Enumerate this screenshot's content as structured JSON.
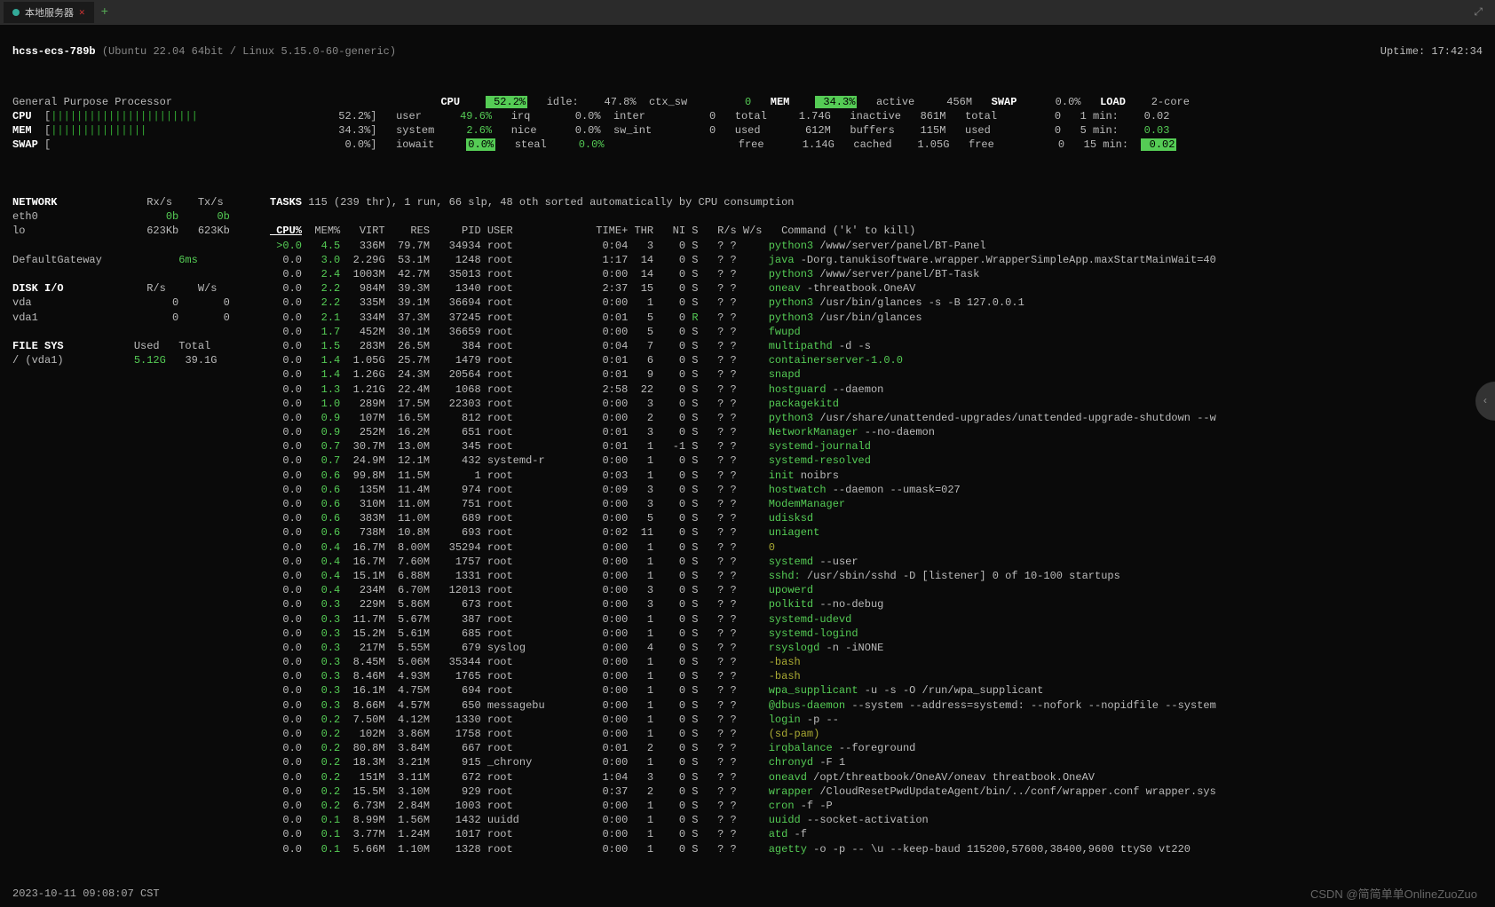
{
  "tab": {
    "label": "本地服务器"
  },
  "header": {
    "host": "hcss-ecs-789b",
    "os": "(Ubuntu 22.04 64bit / Linux 5.15.0-60-generic)",
    "uptime_label": "Uptime:",
    "uptime": "17:42:34"
  },
  "proc_title": "General Purpose Processor",
  "bars": {
    "cpu": {
      "label": "CPU",
      "pct": "52.2%"
    },
    "mem": {
      "label": "MEM",
      "pct": "34.3%"
    },
    "swap": {
      "label": "SWAP",
      "pct": "0.0%"
    }
  },
  "cpu_box": {
    "label": "CPU",
    "main": "52.2%",
    "rows": [
      [
        "user",
        "49.6%",
        "irq",
        "0.0%"
      ],
      [
        "system",
        "2.6%",
        "nice",
        "0.0%"
      ],
      [
        "iowait",
        "0.0%",
        "steal",
        "0.0%"
      ]
    ],
    "extra": [
      [
        "idle:",
        "47.8%",
        "ctx_sw",
        "0"
      ],
      [
        "",
        "",
        "inter",
        "0"
      ],
      [
        "",
        "",
        "sw_int",
        "0"
      ]
    ]
  },
  "mem_box": {
    "label": "MEM",
    "main": "34.3%",
    "rows": [
      [
        "total",
        "1.74G",
        "active",
        "456M"
      ],
      [
        "used",
        "612M",
        "inactive",
        "861M"
      ],
      [
        "free",
        "1.14G",
        "buffers",
        "115M"
      ],
      [
        "",
        "",
        "cached",
        "1.05G"
      ]
    ]
  },
  "swap_box": {
    "label": "SWAP",
    "main": "0.0%",
    "rows": [
      [
        "total",
        "0"
      ],
      [
        "used",
        "0"
      ],
      [
        "free",
        "0"
      ]
    ]
  },
  "load_box": {
    "label": "LOAD",
    "main": "2-core",
    "rows": [
      [
        "1 min:",
        "0.02"
      ],
      [
        "5 min:",
        "0.03"
      ],
      [
        "15 min:",
        "0.02"
      ]
    ]
  },
  "network": {
    "title": "NETWORK",
    "hdr": [
      "Rx/s",
      "Tx/s"
    ],
    "rows": [
      [
        "eth0",
        "0b",
        "0b"
      ],
      [
        "lo",
        "623Kb",
        "623Kb"
      ]
    ],
    "gw": [
      "DefaultGateway",
      "6ms"
    ]
  },
  "diskio": {
    "title": "DISK I/O",
    "hdr": [
      "R/s",
      "W/s"
    ],
    "rows": [
      [
        "vda",
        "0",
        "0"
      ],
      [
        "vda1",
        "0",
        "0"
      ]
    ]
  },
  "fs": {
    "title": "FILE SYS",
    "hdr": [
      "Used",
      "Total"
    ],
    "rows": [
      [
        "/ (vda1)",
        "5.12G",
        "39.1G"
      ]
    ]
  },
  "tasks_hdr": "TASKS 115 (239 thr), 1 run, 66 slp, 48 oth sorted automatically by CPU consumption",
  "cols": [
    "CPU%",
    "MEM%",
    "VIRT",
    "RES",
    "PID",
    "USER",
    "TIME+",
    "THR",
    "NI",
    "S",
    "R/s",
    "W/s",
    "Command ('k' to kill)"
  ],
  "procs": [
    [
      ">0.0",
      "4.5",
      "336M",
      "79.7M",
      "34934",
      "root",
      "0:04",
      "3",
      "0",
      "S",
      "?",
      "?",
      "python3",
      " /www/server/panel/BT-Panel"
    ],
    [
      "0.0",
      "3.0",
      "2.29G",
      "53.1M",
      "1248",
      "root",
      "1:17",
      "14",
      "0",
      "S",
      "?",
      "?",
      "java",
      " -Dorg.tanukisoftware.wrapper.WrapperSimpleApp.maxStartMainWait=40"
    ],
    [
      "0.0",
      "2.4",
      "1003M",
      "42.7M",
      "35013",
      "root",
      "0:00",
      "14",
      "0",
      "S",
      "?",
      "?",
      "python3",
      " /www/server/panel/BT-Task"
    ],
    [
      "0.0",
      "2.2",
      "984M",
      "39.3M",
      "1340",
      "root",
      "2:37",
      "15",
      "0",
      "S",
      "?",
      "?",
      "oneav",
      " -threatbook.OneAV"
    ],
    [
      "0.0",
      "2.2",
      "335M",
      "39.1M",
      "36694",
      "root",
      "0:00",
      "1",
      "0",
      "S",
      "?",
      "?",
      "python3",
      " /usr/bin/glances -s -B 127.0.0.1"
    ],
    [
      "0.0",
      "2.1",
      "334M",
      "37.3M",
      "37245",
      "root",
      "0:01",
      "5",
      "0",
      "R",
      "?",
      "?",
      "python3",
      " /usr/bin/glances"
    ],
    [
      "0.0",
      "1.7",
      "452M",
      "30.1M",
      "36659",
      "root",
      "0:00",
      "5",
      "0",
      "S",
      "?",
      "?",
      "fwupd",
      ""
    ],
    [
      "0.0",
      "1.5",
      "283M",
      "26.5M",
      "384",
      "root",
      "0:04",
      "7",
      "0",
      "S",
      "?",
      "?",
      "multipathd",
      " -d -s"
    ],
    [
      "0.0",
      "1.4",
      "1.05G",
      "25.7M",
      "1479",
      "root",
      "0:01",
      "6",
      "0",
      "S",
      "?",
      "?",
      "containerserver-1.0.0",
      ""
    ],
    [
      "0.0",
      "1.4",
      "1.26G",
      "24.3M",
      "20564",
      "root",
      "0:01",
      "9",
      "0",
      "S",
      "?",
      "?",
      "snapd",
      ""
    ],
    [
      "0.0",
      "1.3",
      "1.21G",
      "22.4M",
      "1068",
      "root",
      "2:58",
      "22",
      "0",
      "S",
      "?",
      "?",
      "hostguard",
      " --daemon"
    ],
    [
      "0.0",
      "1.0",
      "289M",
      "17.5M",
      "22303",
      "root",
      "0:00",
      "3",
      "0",
      "S",
      "?",
      "?",
      "packagekitd",
      ""
    ],
    [
      "0.0",
      "0.9",
      "107M",
      "16.5M",
      "812",
      "root",
      "0:00",
      "2",
      "0",
      "S",
      "?",
      "?",
      "python3",
      " /usr/share/unattended-upgrades/unattended-upgrade-shutdown --w"
    ],
    [
      "0.0",
      "0.9",
      "252M",
      "16.2M",
      "651",
      "root",
      "0:01",
      "3",
      "0",
      "S",
      "?",
      "?",
      "NetworkManager",
      " --no-daemon"
    ],
    [
      "0.0",
      "0.7",
      "30.7M",
      "13.0M",
      "345",
      "root",
      "0:01",
      "1",
      "-1",
      "S",
      "?",
      "?",
      "systemd-journald",
      ""
    ],
    [
      "0.0",
      "0.7",
      "24.9M",
      "12.1M",
      "432",
      "systemd-r",
      "0:00",
      "1",
      "0",
      "S",
      "?",
      "?",
      "systemd-resolved",
      ""
    ],
    [
      "0.0",
      "0.6",
      "99.8M",
      "11.5M",
      "1",
      "root",
      "0:03",
      "1",
      "0",
      "S",
      "?",
      "?",
      "init",
      " noibrs"
    ],
    [
      "0.0",
      "0.6",
      "135M",
      "11.4M",
      "974",
      "root",
      "0:09",
      "3",
      "0",
      "S",
      "?",
      "?",
      "hostwatch",
      " --daemon --umask=027"
    ],
    [
      "0.0",
      "0.6",
      "310M",
      "11.0M",
      "751",
      "root",
      "0:00",
      "3",
      "0",
      "S",
      "?",
      "?",
      "ModemManager",
      ""
    ],
    [
      "0.0",
      "0.6",
      "383M",
      "11.0M",
      "689",
      "root",
      "0:00",
      "5",
      "0",
      "S",
      "?",
      "?",
      "udisksd",
      ""
    ],
    [
      "0.0",
      "0.6",
      "738M",
      "10.8M",
      "693",
      "root",
      "0:02",
      "11",
      "0",
      "S",
      "?",
      "?",
      "uniagent",
      ""
    ],
    [
      "0.0",
      "0.4",
      "16.7M",
      "8.00M",
      "35294",
      "root",
      "0:00",
      "1",
      "0",
      "S",
      "?",
      "?",
      "0",
      ""
    ],
    [
      "0.0",
      "0.4",
      "16.7M",
      "7.60M",
      "1757",
      "root",
      "0:00",
      "1",
      "0",
      "S",
      "?",
      "?",
      "systemd",
      " --user"
    ],
    [
      "0.0",
      "0.4",
      "15.1M",
      "6.88M",
      "1331",
      "root",
      "0:00",
      "1",
      "0",
      "S",
      "?",
      "?",
      "sshd:",
      " /usr/sbin/sshd -D [listener] 0 of 10-100 startups"
    ],
    [
      "0.0",
      "0.4",
      "234M",
      "6.70M",
      "12013",
      "root",
      "0:00",
      "3",
      "0",
      "S",
      "?",
      "?",
      "upowerd",
      ""
    ],
    [
      "0.0",
      "0.3",
      "229M",
      "5.86M",
      "673",
      "root",
      "0:00",
      "3",
      "0",
      "S",
      "?",
      "?",
      "polkitd",
      " --no-debug"
    ],
    [
      "0.0",
      "0.3",
      "11.7M",
      "5.67M",
      "387",
      "root",
      "0:00",
      "1",
      "0",
      "S",
      "?",
      "?",
      "systemd-udevd",
      ""
    ],
    [
      "0.0",
      "0.3",
      "15.2M",
      "5.61M",
      "685",
      "root",
      "0:00",
      "1",
      "0",
      "S",
      "?",
      "?",
      "systemd-logind",
      ""
    ],
    [
      "0.0",
      "0.3",
      "217M",
      "5.55M",
      "679",
      "syslog",
      "0:00",
      "4",
      "0",
      "S",
      "?",
      "?",
      "rsyslogd",
      " -n -iNONE"
    ],
    [
      "0.0",
      "0.3",
      "8.45M",
      "5.06M",
      "35344",
      "root",
      "0:00",
      "1",
      "0",
      "S",
      "?",
      "?",
      "-bash",
      ""
    ],
    [
      "0.0",
      "0.3",
      "8.46M",
      "4.93M",
      "1765",
      "root",
      "0:00",
      "1",
      "0",
      "S",
      "?",
      "?",
      "-bash",
      ""
    ],
    [
      "0.0",
      "0.3",
      "16.1M",
      "4.75M",
      "694",
      "root",
      "0:00",
      "1",
      "0",
      "S",
      "?",
      "?",
      "wpa_supplicant",
      " -u -s -O /run/wpa_supplicant"
    ],
    [
      "0.0",
      "0.3",
      "8.66M",
      "4.57M",
      "650",
      "messagebu",
      "0:00",
      "1",
      "0",
      "S",
      "?",
      "?",
      "@dbus-daemon",
      " --system --address=systemd: --nofork --nopidfile --system"
    ],
    [
      "0.0",
      "0.2",
      "7.50M",
      "4.12M",
      "1330",
      "root",
      "0:00",
      "1",
      "0",
      "S",
      "?",
      "?",
      "login",
      " -p --"
    ],
    [
      "0.0",
      "0.2",
      "102M",
      "3.86M",
      "1758",
      "root",
      "0:00",
      "1",
      "0",
      "S",
      "?",
      "?",
      "(sd-pam)",
      ""
    ],
    [
      "0.0",
      "0.2",
      "80.8M",
      "3.84M",
      "667",
      "root",
      "0:01",
      "2",
      "0",
      "S",
      "?",
      "?",
      "irqbalance",
      " --foreground"
    ],
    [
      "0.0",
      "0.2",
      "18.3M",
      "3.21M",
      "915",
      "_chrony",
      "0:00",
      "1",
      "0",
      "S",
      "?",
      "?",
      "chronyd",
      " -F 1"
    ],
    [
      "0.0",
      "0.2",
      "151M",
      "3.11M",
      "672",
      "root",
      "1:04",
      "3",
      "0",
      "S",
      "?",
      "?",
      "oneavd",
      " /opt/threatbook/OneAV/oneav threatbook.OneAV"
    ],
    [
      "0.0",
      "0.2",
      "15.5M",
      "3.10M",
      "929",
      "root",
      "0:37",
      "2",
      "0",
      "S",
      "?",
      "?",
      "wrapper",
      " /CloudResetPwdUpdateAgent/bin/../conf/wrapper.conf wrapper.sys"
    ],
    [
      "0.0",
      "0.2",
      "6.73M",
      "2.84M",
      "1003",
      "root",
      "0:00",
      "1",
      "0",
      "S",
      "?",
      "?",
      "cron",
      " -f -P"
    ],
    [
      "0.0",
      "0.1",
      "8.99M",
      "1.56M",
      "1432",
      "uuidd",
      "0:00",
      "1",
      "0",
      "S",
      "?",
      "?",
      "uuidd",
      " --socket-activation"
    ],
    [
      "0.0",
      "0.1",
      "3.77M",
      "1.24M",
      "1017",
      "root",
      "0:00",
      "1",
      "0",
      "S",
      "?",
      "?",
      "atd",
      " -f"
    ],
    [
      "0.0",
      "0.1",
      "5.66M",
      "1.10M",
      "1328",
      "root",
      "0:00",
      "1",
      "0",
      "S",
      "?",
      "?",
      "agetty",
      " -o -p -- \\u --keep-baud 115200,57600,38400,9600 ttyS0 vt220"
    ]
  ],
  "footer": "2023-10-11 09:08:07 CST",
  "watermark": "CSDN @简简单单OnlineZuoZuo"
}
